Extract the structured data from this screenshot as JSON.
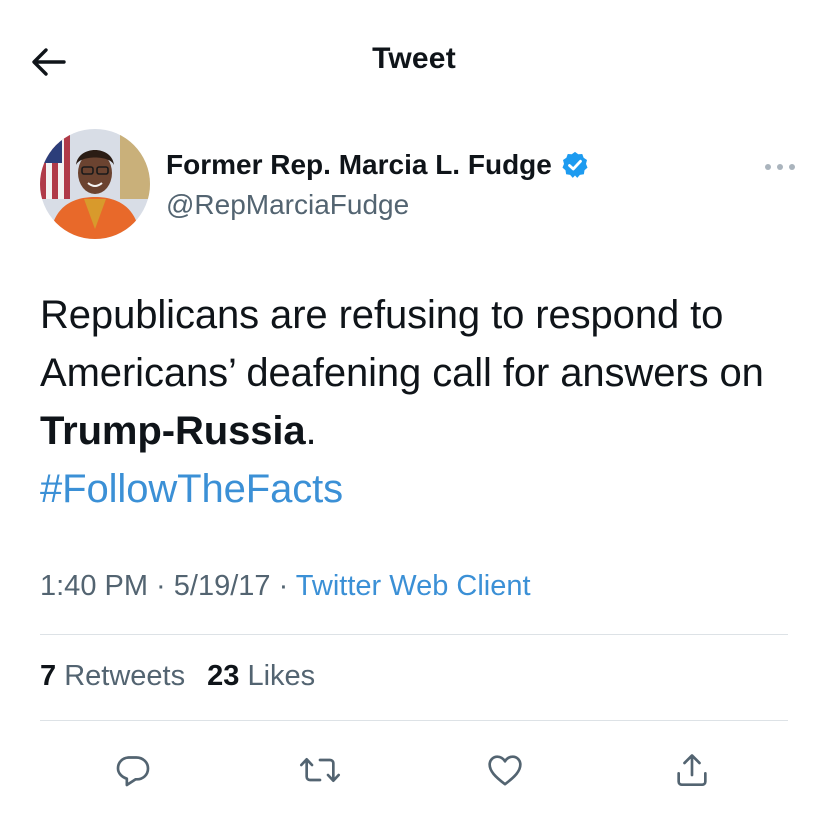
{
  "header": {
    "title": "Tweet",
    "back_icon": "arrow-left-icon"
  },
  "author": {
    "display_name": "Former Rep. Marcia L. Fudge",
    "handle": "@RepMarciaFudge",
    "verified": true,
    "verified_color": "#1d9bf0"
  },
  "tweet": {
    "text_plain": "Republicans are refusing to respond to Americans’ deafening call for answers on ",
    "text_bold": "Trump-Russia",
    "text_end": ".",
    "hashtag": "#FollowTheFacts"
  },
  "meta": {
    "time": "1:40 PM",
    "sep1": " · ",
    "date": "5/19/17",
    "sep2": " · ",
    "source": "Twitter Web Client"
  },
  "stats": {
    "retweets_count": "7",
    "retweets_label": "Retweets",
    "likes_count": "23",
    "likes_label": "Likes"
  },
  "actions": [
    "reply-icon",
    "retweet-icon",
    "like-icon",
    "share-icon"
  ],
  "colors": {
    "link": "#3b90d6",
    "secondary": "#536471",
    "text": "#0f1419",
    "divider": "#dde2e6"
  }
}
